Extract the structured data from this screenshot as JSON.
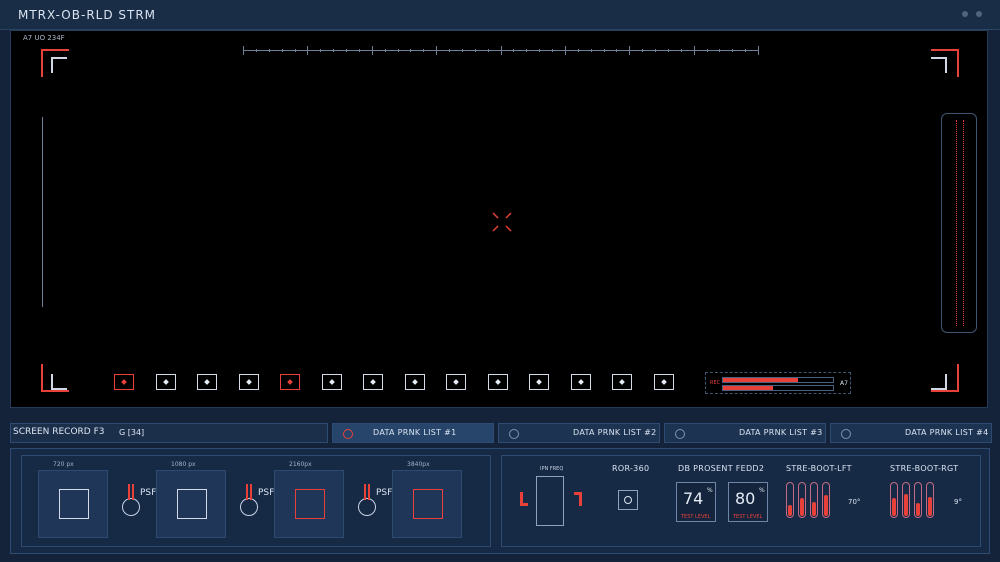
{
  "window": {
    "title": "MTRX-OB-RLD   STRM",
    "viewport_id": "A7 UO 234F"
  },
  "viewport": {
    "rec_label": "REC",
    "rec_channel": "A7",
    "selection_boxes": 14,
    "red_box_indices": [
      0,
      4
    ],
    "rec_levels": [
      0.68,
      0.45
    ]
  },
  "status": {
    "record_label": "SCREEN RECORD F3",
    "record_code": "G [34]",
    "tabs": [
      {
        "label": "DATA PRNK LIST #1",
        "active": true
      },
      {
        "label": "DATA PRNK LIST #2",
        "active": false
      },
      {
        "label": "DATA PRNK LIST #3",
        "active": false
      },
      {
        "label": "DATA PRNK LIST #4",
        "active": false
      }
    ]
  },
  "bottom": {
    "resolutions": [
      {
        "label": "720",
        "unit": "px",
        "red": false
      },
      {
        "label": "1080",
        "unit": "px",
        "red": false
      },
      {
        "label": "2160px",
        "unit": "",
        "red": true
      },
      {
        "label": "3840px",
        "unit": "",
        "red": true
      }
    ],
    "psf_label": "PSF",
    "ipn_freq_label": "IPN FREQ",
    "ror_label": "ROR-360",
    "db_label": "DB PROSENT FEDD2",
    "values": [
      {
        "value": "74",
        "unit": "%",
        "caption": "TEST LEVEL"
      },
      {
        "value": "80",
        "unit": "%",
        "caption": "TEST LEVEL"
      }
    ],
    "boot_left": {
      "label": "STRE-BOOT-LFT",
      "reading": "70°"
    },
    "boot_right": {
      "label": "STRE-BOOT-RGT",
      "reading": "9°"
    },
    "pill_levels_left": [
      0.35,
      0.55,
      0.45,
      0.65
    ],
    "pill_levels_right": [
      0.55,
      0.7,
      0.4,
      0.6
    ]
  },
  "colors": {
    "accent_red": "#e8413a",
    "panel": "#172a45",
    "frame": "#2e4c72"
  }
}
